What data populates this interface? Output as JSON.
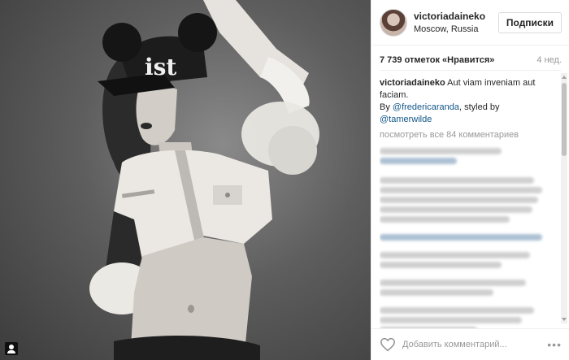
{
  "header": {
    "username": "victoriadaineko",
    "location": "Moscow, Russia",
    "follow_label": "Подписки"
  },
  "stats": {
    "likes": "7 739 отметок «Нравится»",
    "time": "4 нед."
  },
  "caption": {
    "user": "victoriadaineko",
    "text": " Aut viam inveniam aut faciam.",
    "by_prefix": "By ",
    "credit_user": "@fredericaranda",
    "styled_by": ", styled by",
    "stylist_user": "@tamerwilde"
  },
  "view_all": "посмотреть все 84 комментариев",
  "footer": {
    "comment_placeholder": "Добавить комментарий...",
    "more_label": "•••"
  },
  "photo": {
    "cap_text": "ist"
  },
  "colors": {
    "link": "#125688",
    "muted": "#999999",
    "border": "#efefef"
  },
  "icons": [
    "user-tag-icon",
    "heart-icon",
    "more-options-icon"
  ]
}
